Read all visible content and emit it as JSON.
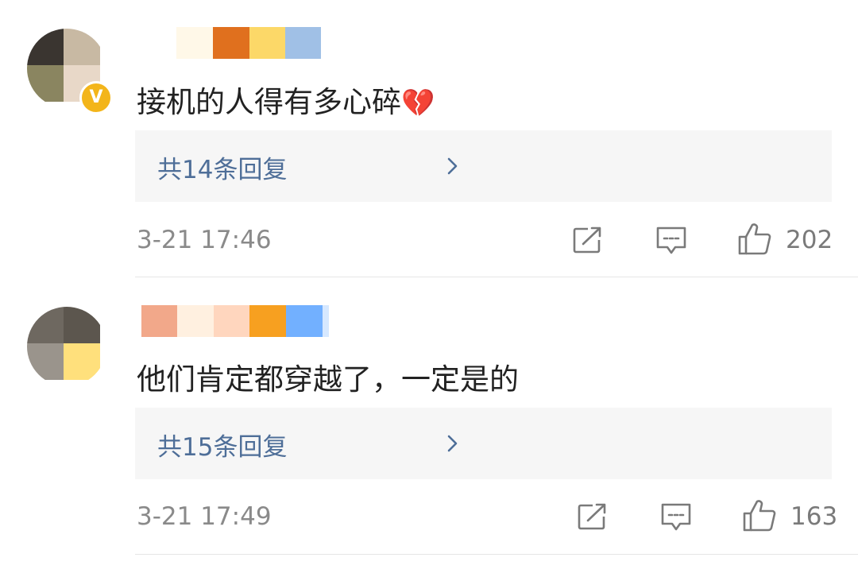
{
  "comments": [
    {
      "text": "接机的人得有多心碎",
      "emoji": "💔",
      "replies_label": "共14条回复",
      "timestamp": "3-21 17:46",
      "likes": "202",
      "verified_badge": "V"
    },
    {
      "text": "他们肯定都穿越了，一定是的",
      "replies_label": "共15条回复",
      "timestamp": "3-21 17:49",
      "likes": "163"
    }
  ],
  "colors": {
    "reply_link": "#4e6e98",
    "meta_text": "#8a8a8a",
    "reply_bg": "#f6f6f6",
    "badge": "#f3b51a",
    "broken_heart": "#d8222e"
  },
  "icons": [
    "repost-icon",
    "comment-icon",
    "like-icon",
    "chevron-right-icon",
    "broken-heart-emoji"
  ]
}
